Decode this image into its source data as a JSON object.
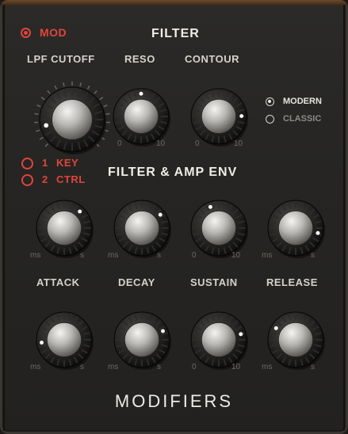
{
  "filter": {
    "title": "FILTER",
    "mod_label": "MOD",
    "knobs": [
      {
        "label": "LPF CUTOFF",
        "value": 0.12
      },
      {
        "label": "RESO",
        "value": 0.5,
        "min": "0",
        "max": "10"
      },
      {
        "label": "CONTOUR",
        "value": 0.83,
        "min": "0",
        "max": "10"
      }
    ],
    "mode": {
      "options": [
        "MODERN",
        "CLASSIC"
      ],
      "selected": "MODERN"
    },
    "keytrack": [
      {
        "num": "1",
        "label": "KEY"
      },
      {
        "num": "2",
        "label": "CTRL"
      }
    ]
  },
  "env": {
    "title": "FILTER & AMP ENV",
    "row1": [
      {
        "name": "attack",
        "value": 0.66,
        "min": "ms",
        "max": "s"
      },
      {
        "name": "decay",
        "value": 0.7,
        "min": "ms",
        "max": "s"
      },
      {
        "name": "sustain",
        "value": 0.42,
        "min": "0",
        "max": "10"
      },
      {
        "name": "release",
        "value": 0.88,
        "min": "ms",
        "max": "s"
      }
    ],
    "labels": [
      "ATTACK",
      "DECAY",
      "SUSTAIN",
      "RELEASE"
    ],
    "row2": [
      {
        "name": "attack",
        "value": 0.14,
        "min": "ms",
        "max": "s"
      },
      {
        "name": "decay",
        "value": 0.75,
        "min": "ms",
        "max": "s"
      },
      {
        "name": "sustain",
        "value": 0.78,
        "min": "0",
        "max": "10"
      },
      {
        "name": "release",
        "value": 0.28,
        "min": "ms",
        "max": "s"
      }
    ]
  },
  "footer": "MODIFIERS",
  "colors": {
    "accent": "#e0453c",
    "text": "#d6d2cb",
    "background": "#262523"
  }
}
